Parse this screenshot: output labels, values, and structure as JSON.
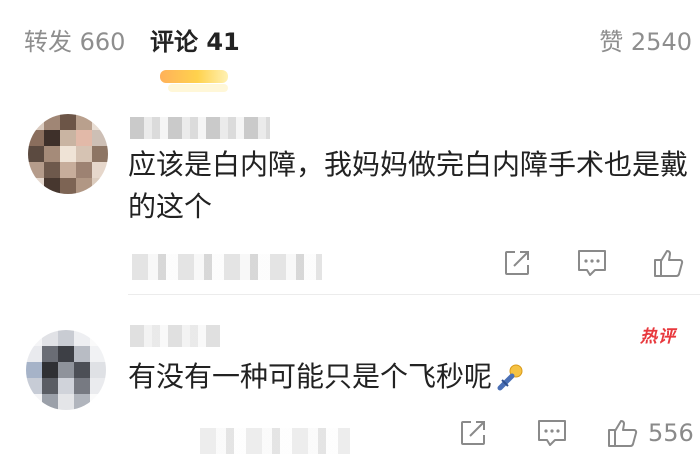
{
  "tabs": {
    "repost": "转发 660",
    "comments": "评论 41",
    "likes": "赞 2540"
  },
  "comments": [
    {
      "text": "应该是白内障，我妈妈做完白内障手术也是戴的这个",
      "like_count": ""
    },
    {
      "text": "有没有一种可能只是个飞秒呢",
      "hot_badge": "热评",
      "like_count": "556"
    }
  ],
  "icons": {
    "share": "share-icon",
    "reply": "comment-icon",
    "like": "thumbs-up-icon",
    "emoji": "pin-emoji-icon"
  },
  "colors": {
    "accent_underline": "#ffc04d",
    "hot_badge": "#e8383d",
    "muted_text": "#8e8e8e"
  }
}
